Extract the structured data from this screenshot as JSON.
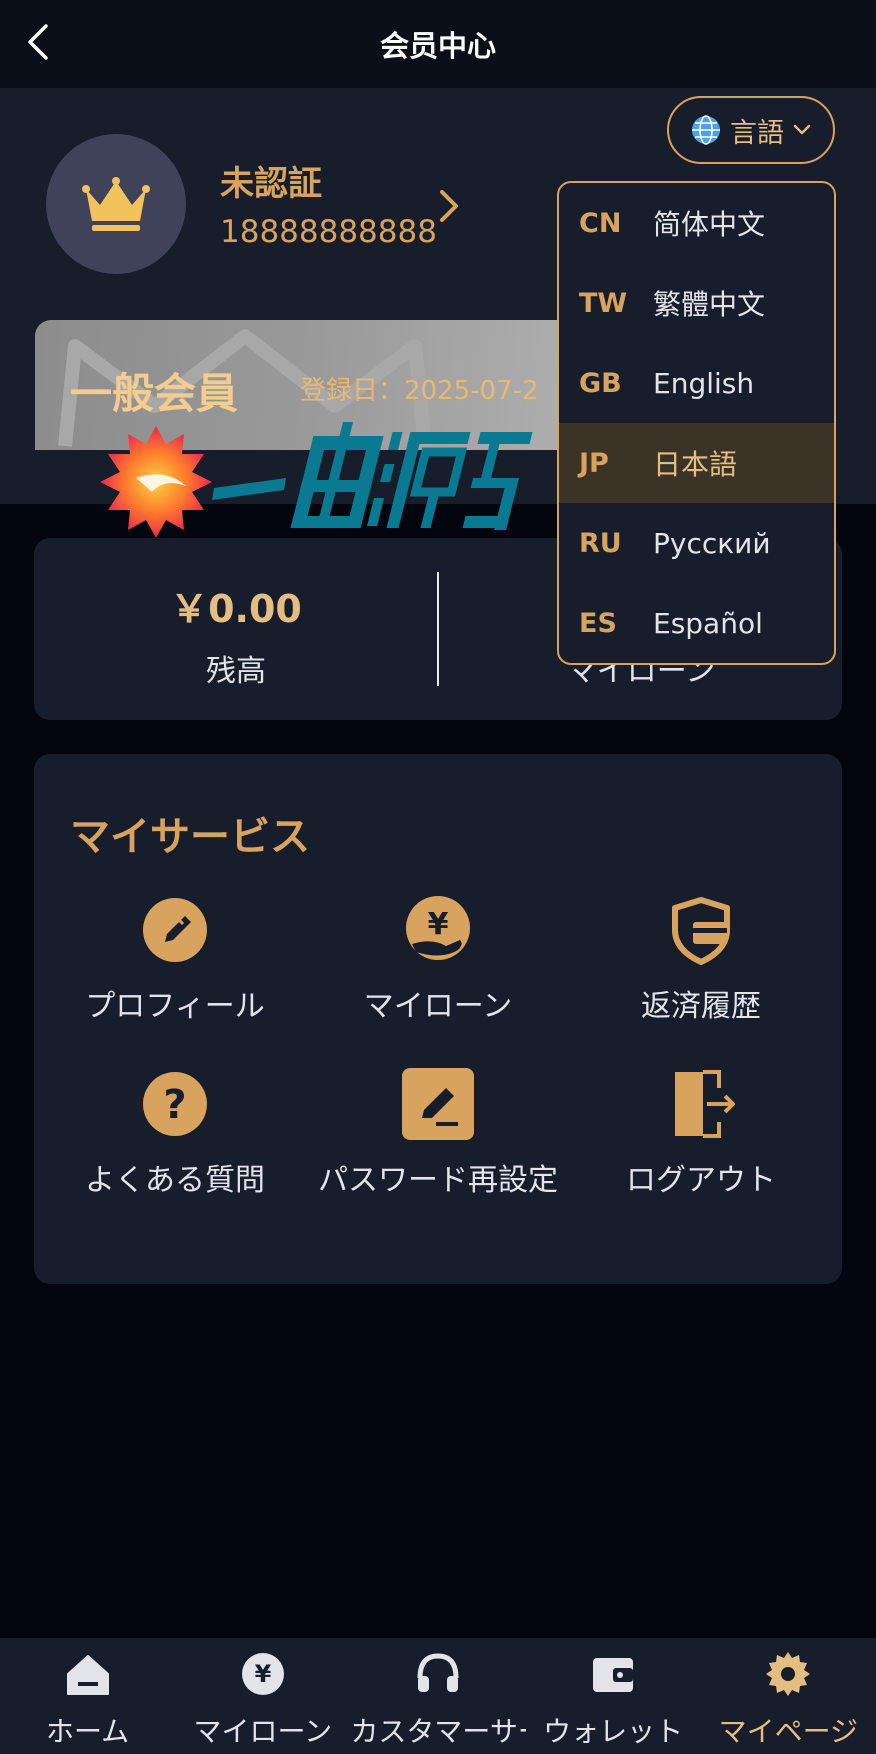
{
  "header": {
    "title": "会员中心"
  },
  "profile": {
    "status": "未認証",
    "phone": "18888888888",
    "language_button": "言語"
  },
  "member_card": {
    "level": "一般会員",
    "date_text": "登録日：2025-07-2"
  },
  "balance": {
    "value": "￥0.00",
    "label": "残高",
    "loan_label": "マイローン"
  },
  "services": {
    "title": "マイサービス",
    "items": [
      {
        "label": "プロフィール",
        "icon": "edit-circle-icon"
      },
      {
        "label": "マイローン",
        "icon": "yen-hand-icon"
      },
      {
        "label": "返済履歴",
        "icon": "shield-card-icon"
      },
      {
        "label": "よくある質問",
        "icon": "question-icon"
      },
      {
        "label": "パスワード再設定",
        "icon": "pencil-square-icon"
      },
      {
        "label": "ログアウト",
        "icon": "logout-icon"
      }
    ]
  },
  "language_menu": {
    "selected": "JP",
    "options": [
      {
        "code": "CN",
        "name": "简体中文"
      },
      {
        "code": "TW",
        "name": "繁體中文"
      },
      {
        "code": "GB",
        "name": "English"
      },
      {
        "code": "JP",
        "name": "日本語"
      },
      {
        "code": "RU",
        "name": "Русский"
      },
      {
        "code": "ES",
        "name": "Español"
      }
    ]
  },
  "nav": {
    "active": "mypage",
    "items": [
      {
        "label": "ホーム",
        "icon": "home-icon"
      },
      {
        "label": "マイローン",
        "icon": "yen-coin-icon"
      },
      {
        "label": "カスタマーサービス",
        "icon": "headset-icon"
      },
      {
        "label": "ウォレット",
        "icon": "wallet-icon"
      },
      {
        "label": "マイページ",
        "icon": "gear-icon"
      }
    ]
  },
  "colors": {
    "accent": "#d8a25f",
    "background": "#03060e",
    "card": "#181d2b"
  }
}
